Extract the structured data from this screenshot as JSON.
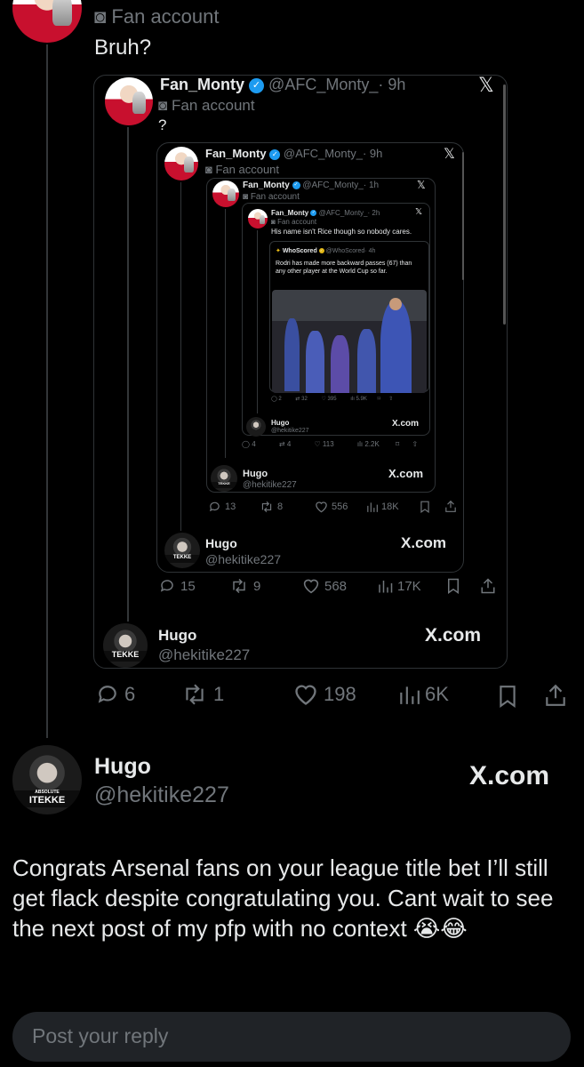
{
  "top_reply": {
    "label": "Fan account",
    "text": "Bruh?"
  },
  "quote1": {
    "display_name": "Fan_Monty",
    "handle": "@AFC_Monty_",
    "time": "· 9h",
    "label": "Fan account",
    "text": "?",
    "hugo": {
      "display_name": "Hugo",
      "handle": "@hekitike227",
      "source": "X.com"
    },
    "stats": {
      "replies": "6",
      "reposts": "1",
      "likes": "198",
      "views": "6K"
    }
  },
  "quote2": {
    "display_name": "Fan_Monty",
    "handle": "@AFC_Monty_",
    "time": "· 9h",
    "label": "Fan account",
    "hugo": {
      "display_name": "Hugo",
      "handle": "@hekitike227",
      "source": "X.com"
    },
    "stats": {
      "replies": "15",
      "reposts": "9",
      "likes": "568",
      "views": "17K"
    }
  },
  "quote3": {
    "display_name": "Fan_Monty",
    "handle": "@AFC_Monty_",
    "time": "· 1h",
    "label": "Fan account",
    "hugo": {
      "display_name": "Hugo",
      "handle": "@hekitike227",
      "source": "X.com"
    },
    "stats": {
      "replies": "13",
      "reposts": "8",
      "likes": "556",
      "views": "18K"
    }
  },
  "quote4": {
    "display_name": "Fan_Monty",
    "handle": "@AFC_Monty_",
    "time": "· 2h",
    "label": "Fan account",
    "text": "His name isn't Rice though so nobody cares.",
    "hugo": {
      "display_name": "Hugo",
      "handle": "@hekitike227",
      "source": "X.com"
    },
    "stats": {
      "replies": "4",
      "reposts": "4",
      "likes": "113",
      "views": "2.2K"
    }
  },
  "whoscored": {
    "display_name": "WhoScored",
    "handle": "@WhoScored",
    "time": "· 4h",
    "text": "Rodri has made more backward passes (67) than any other player at the World Cup so far.",
    "stats": {
      "replies": "2",
      "reposts": "32",
      "likes": "395",
      "views": "5.9K"
    }
  },
  "main": {
    "display_name": "Hugo",
    "handle": "@hekitike227",
    "source": "X.com",
    "avatar_text": "ABSOLUTE",
    "avatar_text2": "ITEKKE",
    "body": "Congrats Arsenal fans on your league title bet I’ll still get flack despite congratulating you. Cant wait to see the next post of my pfp with no context 😭😂"
  },
  "reply_box": {
    "placeholder": "Post your reply"
  }
}
